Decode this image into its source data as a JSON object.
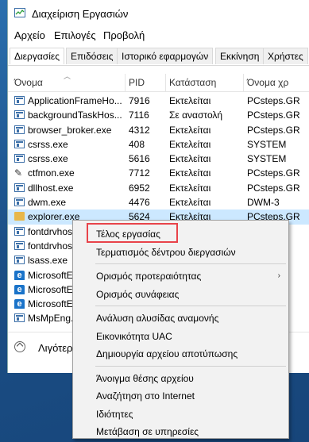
{
  "window": {
    "title": "Διαχείριση Εργασιών",
    "menu": [
      "Αρχείο",
      "Επιλογές",
      "Προβολή"
    ],
    "tabs": [
      "Διεργασίες",
      "Επιδόσεις",
      "Ιστορικό εφαρμογών",
      "Εκκίνηση",
      "Χρήστες"
    ],
    "columns": {
      "name": "Όνομα",
      "pid": "PID",
      "status": "Κατάσταση",
      "user": "Όνομα χρ"
    },
    "rows": [
      {
        "icon": "app-icon",
        "name": "ApplicationFrameHo...",
        "pid": "7916",
        "status": "Εκτελείται",
        "user": "PCsteps.GR"
      },
      {
        "icon": "app-icon",
        "name": "backgroundTaskHos...",
        "pid": "7116",
        "status": "Σε αναστολή",
        "user": "PCsteps.GR"
      },
      {
        "icon": "app-icon",
        "name": "browser_broker.exe",
        "pid": "4312",
        "status": "Εκτελείται",
        "user": "PCsteps.GR"
      },
      {
        "icon": "app-icon",
        "name": "csrss.exe",
        "pid": "408",
        "status": "Εκτελείται",
        "user": "SYSTEM"
      },
      {
        "icon": "app-icon",
        "name": "csrss.exe",
        "pid": "5616",
        "status": "Εκτελείται",
        "user": "SYSTEM"
      },
      {
        "icon": "pen-icon",
        "name": "ctfmon.exe",
        "pid": "7712",
        "status": "Εκτελείται",
        "user": "PCsteps.GR"
      },
      {
        "icon": "app-icon",
        "name": "dllhost.exe",
        "pid": "6952",
        "status": "Εκτελείται",
        "user": "PCsteps.GR"
      },
      {
        "icon": "app-icon",
        "name": "dwm.exe",
        "pid": "4476",
        "status": "Εκτελείται",
        "user": "DWM-3"
      },
      {
        "icon": "folder-icon",
        "name": "explorer.exe",
        "pid": "5624",
        "status": "Εκτελείται",
        "user": "PCsteps.GR"
      },
      {
        "icon": "app-icon",
        "name": "fontdrvhost.exe",
        "pid": "",
        "status": "",
        "user": ""
      },
      {
        "icon": "app-icon",
        "name": "fontdrvhost.exe",
        "pid": "",
        "status": "",
        "user": ""
      },
      {
        "icon": "app-icon",
        "name": "lsass.exe",
        "pid": "",
        "status": "",
        "user": ""
      },
      {
        "icon": "edge-icon",
        "name": "MicrosoftEdge.exe",
        "pid": "",
        "status": "",
        "user": ""
      },
      {
        "icon": "edge-icon",
        "name": "MicrosoftEdgeCP.exe",
        "pid": "",
        "status": "",
        "user": ""
      },
      {
        "icon": "edge-icon",
        "name": "MicrosoftEdgeSH.exe",
        "pid": "",
        "status": "",
        "user": ""
      },
      {
        "icon": "app-icon",
        "name": "MsMpEng.exe",
        "pid": "",
        "status": "",
        "user": ""
      }
    ],
    "footer": "Λιγότερες λεπτομέρειες"
  },
  "context_menu": {
    "groups": [
      [
        "Τέλος εργασίας",
        "Τερματισμός δέντρου διεργασιών"
      ],
      [
        "Ορισμός προτεραιότητας",
        "Ορισμός συνάφειας"
      ],
      [
        "Ανάλυση αλυσίδας αναμονής",
        "Εικονικότητα UAC",
        "Δημιουργία αρχείου αποτύπωσης"
      ],
      [
        "Άνοιγμα θέσης αρχείου",
        "Αναζήτηση στο Internet",
        "Ιδιότητες",
        "Μετάβαση σε υπηρεσίες"
      ]
    ],
    "highlighted": "Τέλος εργασίας",
    "submenu_indicator": "›"
  },
  "colors": {
    "highlight_box": "#e8434a",
    "selected_row": "#cce8ff"
  }
}
